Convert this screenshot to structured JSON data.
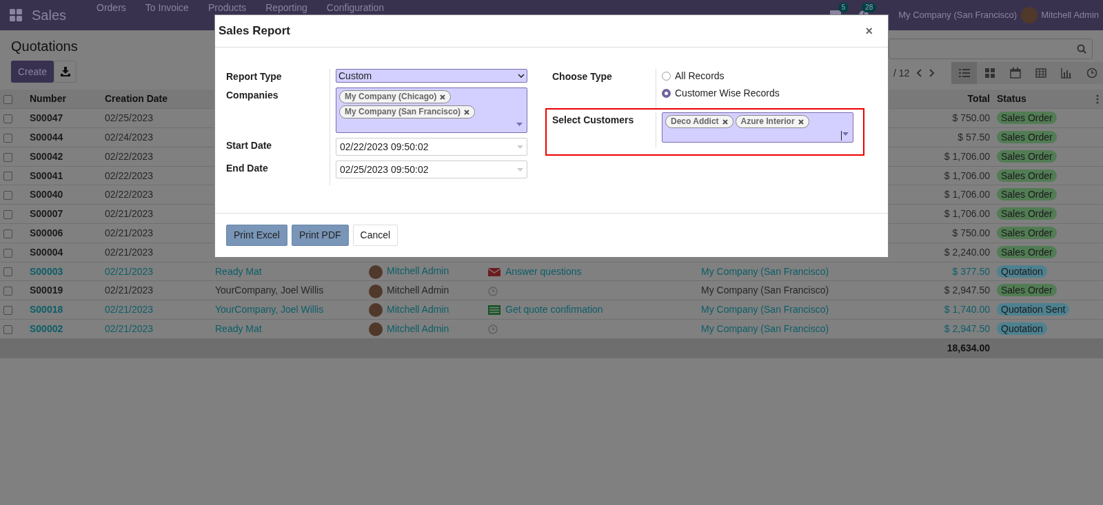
{
  "navbar": {
    "app_name": "Sales",
    "menu": [
      "Orders",
      "To Invoice",
      "Products",
      "Reporting",
      "Configuration"
    ],
    "messages_badge": "5",
    "activities_badge": "28",
    "company": "My Company (San Francisco)",
    "user": "Mitchell Admin"
  },
  "control_panel": {
    "title": "Quotations",
    "create_button": "Create",
    "pager": "/ 12",
    "views": [
      {
        "kind": "list",
        "selected": true
      },
      {
        "kind": "kanban",
        "selected": false
      },
      {
        "kind": "calendar",
        "selected": false
      },
      {
        "kind": "pivot",
        "selected": false
      },
      {
        "kind": "graph",
        "selected": false
      },
      {
        "kind": "activity",
        "selected": false
      }
    ]
  },
  "table": {
    "select_all_checked": false,
    "header": {
      "number": "Number",
      "creation_date": "Creation Date",
      "total": "Total",
      "status": "Status"
    },
    "rows": [
      {
        "checked": false,
        "is_quotation": false,
        "number": "S00047",
        "creation_date": "02/25/2023",
        "total": "$ 750.00",
        "status": {
          "label": "Sales Order",
          "color": "#527c54"
        }
      },
      {
        "checked": false,
        "is_quotation": false,
        "number": "S00044",
        "creation_date": "02/24/2023",
        "total": "$ 57.50",
        "status": {
          "label": "Sales Order",
          "color": "#527c54"
        }
      },
      {
        "checked": false,
        "is_quotation": false,
        "number": "S00042",
        "creation_date": "02/22/2023",
        "total": "$ 1,706.00",
        "status": {
          "label": "Sales Order",
          "color": "#527c54"
        }
      },
      {
        "checked": false,
        "is_quotation": false,
        "number": "S00041",
        "creation_date": "02/22/2023",
        "total": "$ 1,706.00",
        "status": {
          "label": "Sales Order",
          "color": "#527c54"
        }
      },
      {
        "checked": false,
        "is_quotation": false,
        "number": "S00040",
        "creation_date": "02/22/2023",
        "total": "$ 1,706.00",
        "status": {
          "label": "Sales Order",
          "color": "#527c54"
        }
      },
      {
        "checked": false,
        "is_quotation": false,
        "number": "S00007",
        "creation_date": "02/21/2023",
        "total": "$ 1,706.00",
        "status": {
          "label": "Sales Order",
          "color": "#527c54"
        }
      },
      {
        "checked": false,
        "is_quotation": false,
        "number": "S00006",
        "creation_date": "02/21/2023",
        "total": "$ 750.00",
        "status": {
          "label": "Sales Order",
          "color": "#527c54"
        }
      },
      {
        "checked": false,
        "is_quotation": false,
        "number": "S00004",
        "creation_date": "02/21/2023",
        "total": "$ 2,240.00",
        "status": {
          "label": "Sales Order",
          "color": "#527c54"
        }
      },
      {
        "checked": false,
        "is_quotation": true,
        "number": "S00003",
        "creation_date": "02/21/2023",
        "customer": "Ready Mat",
        "salesperson": "Mitchell Admin",
        "activity": {
          "kind": "email",
          "text": "Answer questions"
        },
        "company": "My Company (San Francisco)",
        "total": "$ 377.50",
        "status": {
          "label": "Quotation",
          "color": "#4e8190"
        }
      },
      {
        "checked": false,
        "is_quotation": false,
        "number": "S00019",
        "creation_date": "02/21/2023",
        "customer": "YourCompany, Joel Willis",
        "salesperson": "Mitchell Admin",
        "activity": {
          "kind": "clock"
        },
        "company": "My Company (San Francisco)",
        "total": "$ 2,947.50",
        "status": {
          "label": "Sales Order",
          "color": "#527c54"
        }
      },
      {
        "checked": false,
        "is_quotation": true,
        "number": "S00018",
        "creation_date": "02/21/2023",
        "customer": "YourCompany, Joel Willis",
        "salesperson": "Mitchell Admin",
        "activity": {
          "kind": "todo",
          "text": "Get quote confirmation"
        },
        "company": "My Company (San Francisco)",
        "total": "$ 1,740.00",
        "status": {
          "label": "Quotation Sent",
          "color": "#4e8190"
        }
      },
      {
        "checked": false,
        "is_quotation": true,
        "number": "S00002",
        "creation_date": "02/21/2023",
        "customer": "Ready Mat",
        "salesperson": "Mitchell Admin",
        "activity": {
          "kind": "clock"
        },
        "company": "My Company (San Francisco)",
        "total": "$ 2,947.50",
        "status": {
          "label": "Quotation",
          "color": "#4e8190"
        }
      }
    ],
    "sum_total": "18,634.00"
  },
  "dialog": {
    "title": "Sales Report",
    "close": "×",
    "left_fields": [
      {
        "kind": "select",
        "label": "Report Type",
        "value": "Custom"
      },
      {
        "kind": "tags",
        "label": "Companies",
        "tags": [
          "My Company (Chicago)",
          "My Company (San Francisco)"
        ]
      },
      {
        "kind": "date",
        "label": "Start Date",
        "value": "02/22/2023 09:50:02"
      },
      {
        "kind": "date",
        "label": "End Date",
        "value": "02/25/2023 09:50:02"
      }
    ],
    "right_fields": [
      {
        "kind": "radio",
        "label": "Choose Type",
        "highlighted": false,
        "options": [
          {
            "label": "All Records",
            "selected": false
          },
          {
            "label": "Customer Wise Records",
            "selected": true
          }
        ]
      },
      {
        "kind": "tags",
        "label": "Select Customers",
        "highlighted": true,
        "tags": [
          "Deco Addict",
          "Azure Interior"
        ]
      }
    ],
    "buttons": [
      {
        "label": "Print Excel",
        "kind": "primary"
      },
      {
        "label": "Print PDF",
        "kind": "primary"
      },
      {
        "label": "Cancel",
        "kind": "secondary"
      }
    ]
  }
}
